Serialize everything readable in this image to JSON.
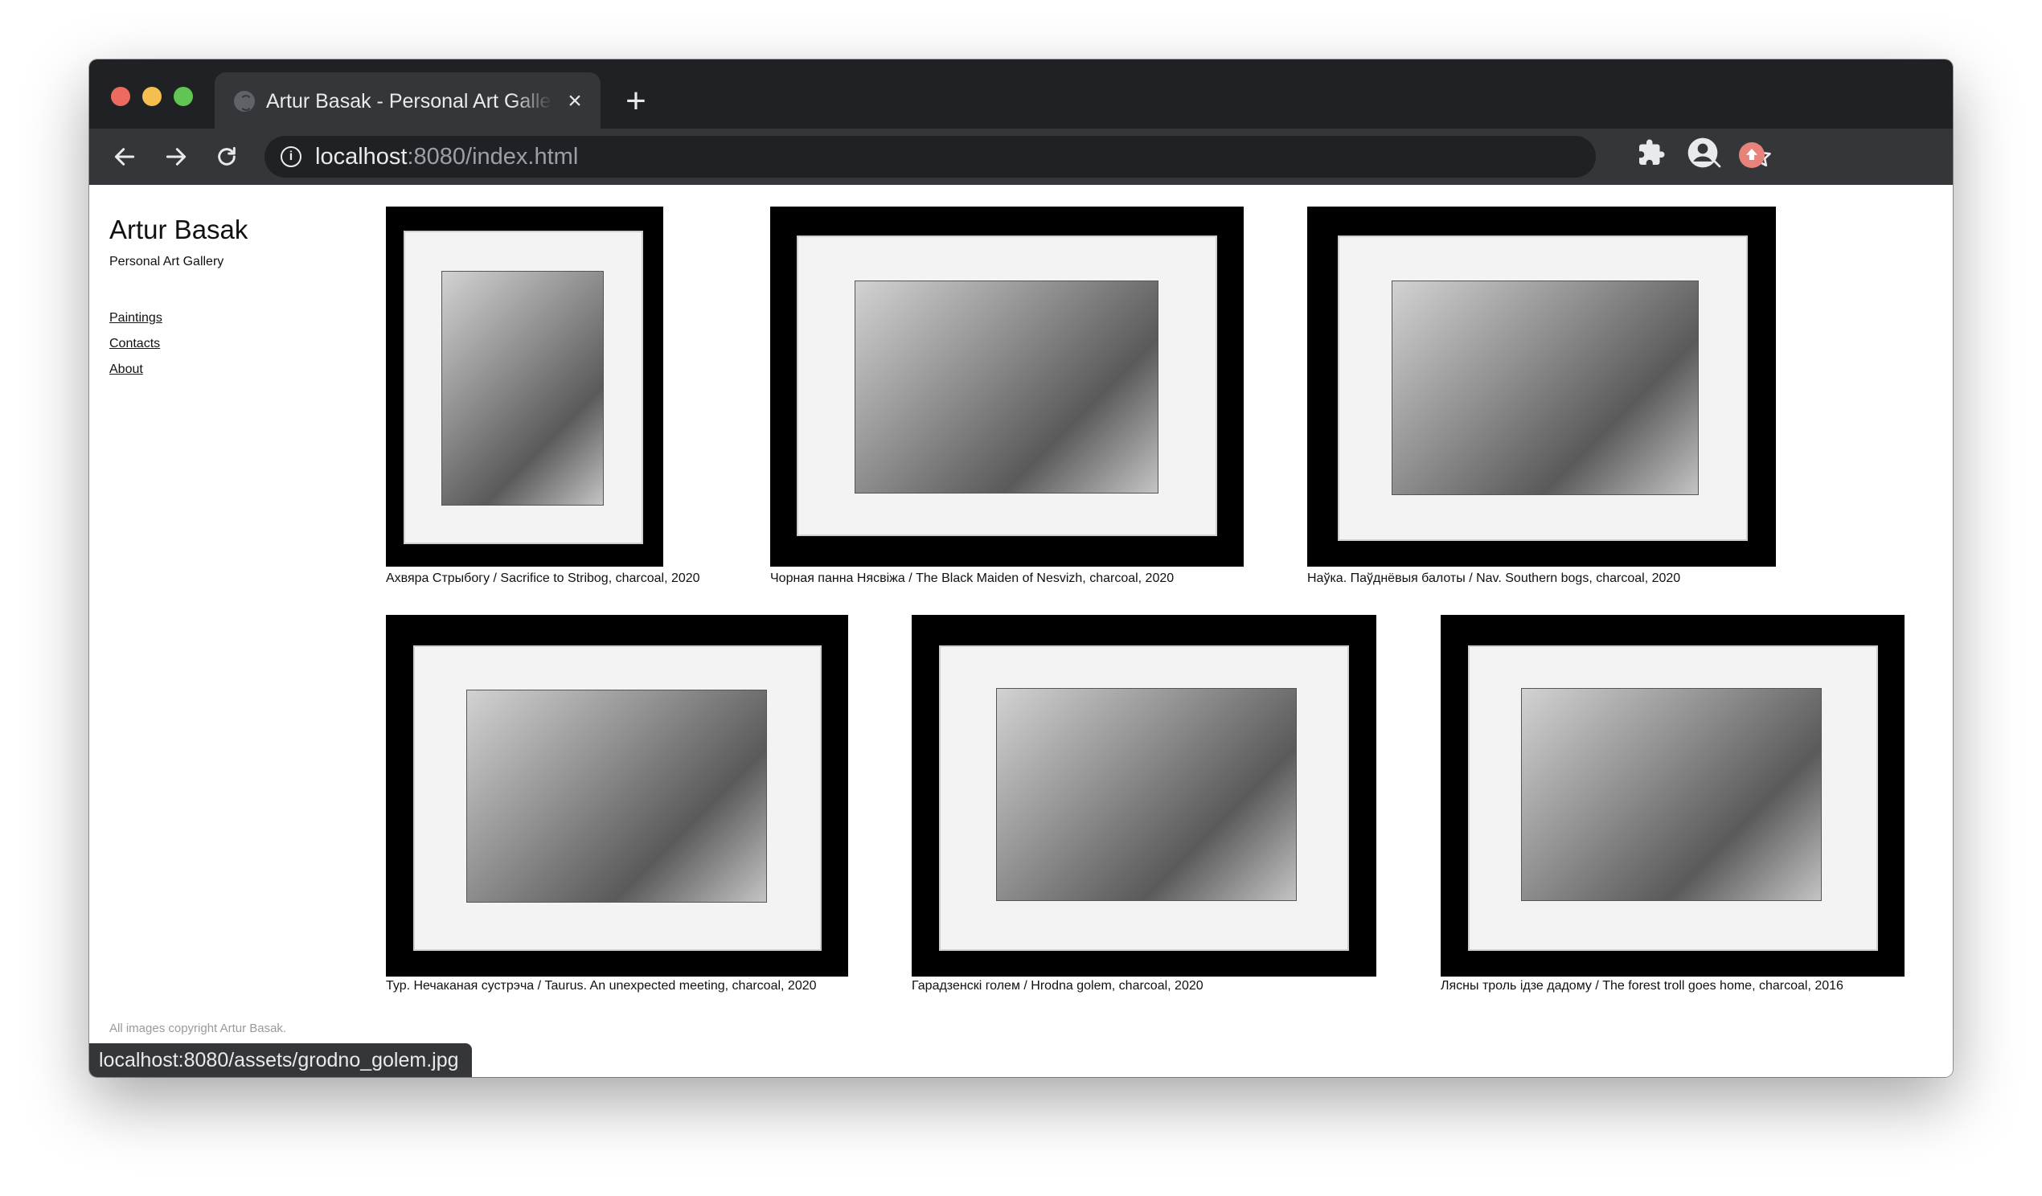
{
  "browser": {
    "tab_title": "Artur Basak - Personal Art Gallery",
    "url_host": "localhost",
    "url_path": ":8080/index.html",
    "new_tab_label": "+",
    "close_label": "×",
    "status_url": "localhost:8080/assets/grodno_golem.jpg"
  },
  "site": {
    "title": "Artur Basak",
    "subtitle": "Personal Art Gallery",
    "nav": [
      {
        "label": "Paintings"
      },
      {
        "label": "Contacts"
      },
      {
        "label": "About"
      }
    ],
    "footer": "All images copyright Artur Basak."
  },
  "artworks": [
    {
      "caption": "Ахвяра Стрыбогу / Sacrifice to Stribog, charcoal, 2020"
    },
    {
      "caption": "Чорная панна Нясвіжа / The Black Maiden of Nesvizh, charcoal, 2020"
    },
    {
      "caption": "Наўка. Паўднёвыя балоты / Nav. Southern bogs, charcoal, 2020"
    },
    {
      "caption": "Тур. Нечаканая сустрэча / Taurus. An unexpected meeting, charcoal, 2020"
    },
    {
      "caption": "Гарадзенскі голем / Hrodna golem, charcoal, 2020"
    },
    {
      "caption": "Лясны троль ідзе дадому / The forest troll goes home, charcoal, 2016"
    }
  ],
  "icons": {
    "back": "arrow-left-icon",
    "forward": "arrow-right-icon",
    "reload": "reload-icon",
    "info": "info-icon",
    "zoom": "zoom-out-icon",
    "bookmark": "star-icon",
    "extensions": "puzzle-icon",
    "profile": "account-icon",
    "extension_2": "home-icon"
  },
  "colors": {
    "tabstrip": "#202124",
    "toolbar": "#35363a",
    "omnibox": "#202124",
    "frame": "#000000",
    "mat": "#f3f3f3"
  }
}
